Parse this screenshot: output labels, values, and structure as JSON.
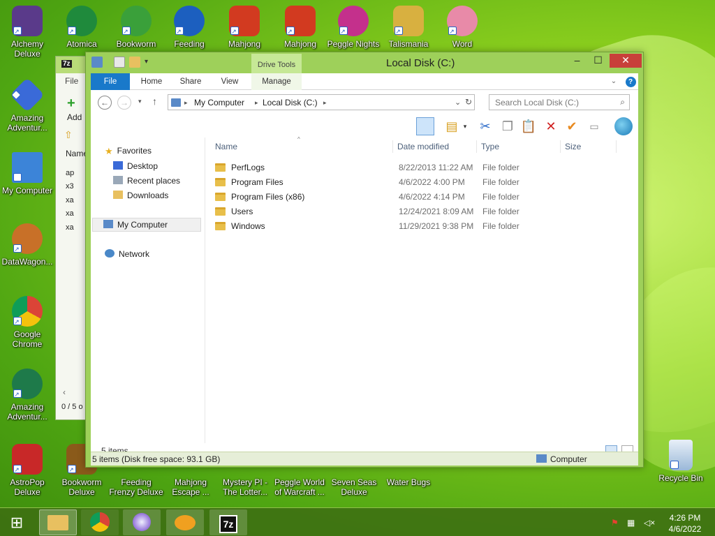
{
  "desktop": {
    "icons_top": [
      {
        "label": "Alchemy Deluxe",
        "color": "#5a3a8a"
      },
      {
        "label": "Atomica",
        "color": "#1f8a3c"
      },
      {
        "label": "Bookworm",
        "color": "#3aa03a"
      },
      {
        "label": "Feeding",
        "color": "#1c5fbf"
      },
      {
        "label": "Mahjong",
        "color": "#d23a20"
      },
      {
        "label": "Mahjong",
        "color": "#d23a20"
      },
      {
        "label": "Peggle Nights",
        "color": "#c4308c"
      },
      {
        "label": "Talismania",
        "color": "#d8b040"
      },
      {
        "label": "Word",
        "color": "#e88aa8"
      }
    ],
    "icons_left": [
      {
        "label": "Amazing Adventur...",
        "color": "#3a6ad8"
      },
      {
        "label": "My Computer",
        "color": "#3c84d8"
      },
      {
        "label": "DataWagon...",
        "color": "#c87028"
      },
      {
        "label": "Google Chrome",
        "color": "#d83a2a"
      },
      {
        "label": "Amazing Adventur...",
        "color": "#1e7a4a"
      }
    ],
    "icons_bottom": [
      {
        "label": "AstroPop Deluxe",
        "color": "#c82828"
      },
      {
        "label": "Bookworm Deluxe",
        "color": "#8a5a1a"
      },
      {
        "label": "Feeding Frenzy Deluxe",
        "color": "#2a78c8"
      },
      {
        "label": "Mahjong Escape ...",
        "color": "#a83a2a"
      },
      {
        "label": "Mystery PI - The Lotter...",
        "color": "#4a4a6a"
      },
      {
        "label": "Peggle World of Warcraft ...",
        "color": "#5a3a9a"
      },
      {
        "label": "Seven Seas Deluxe",
        "color": "#2a6aa8"
      },
      {
        "label": "Water Bugs",
        "color": "#3aa8a8"
      },
      {
        "label": "Recycle Bin",
        "color": "#9ab8d8"
      }
    ]
  },
  "bg_window": {
    "title_icon": "7z",
    "menu_file": "File",
    "add_label": "Add",
    "col_name": "Name",
    "items": [
      "ap",
      "x3",
      "xa",
      "xa",
      "xa"
    ],
    "status": "0 / 5 o"
  },
  "window": {
    "title": "Local Disk (C:)",
    "context_tab": "Drive Tools",
    "tabs": {
      "file": "File",
      "home": "Home",
      "share": "Share",
      "view": "View",
      "manage": "Manage"
    },
    "help": "?",
    "address": {
      "root": "My Computer",
      "current": "Local Disk (C:)"
    },
    "search_placeholder": "Search Local Disk (C:)",
    "columns": {
      "name": "Name",
      "date": "Date modified",
      "type": "Type",
      "size": "Size"
    },
    "nav": {
      "favorites": "Favorites",
      "desktop": "Desktop",
      "recent": "Recent places",
      "downloads": "Downloads",
      "mycomputer": "My Computer",
      "network": "Network"
    },
    "files": [
      {
        "name": "PerfLogs",
        "date": "8/22/2013 11:22 AM",
        "type": "File folder"
      },
      {
        "name": "Program Files",
        "date": "4/6/2022 4:00 PM",
        "type": "File folder"
      },
      {
        "name": "Program Files (x86)",
        "date": "4/6/2022 4:14 PM",
        "type": "File folder"
      },
      {
        "name": "Users",
        "date": "12/24/2021 8:09 AM",
        "type": "File folder"
      },
      {
        "name": "Windows",
        "date": "11/29/2021 9:38 PM",
        "type": "File folder"
      }
    ],
    "item_count": "5 items",
    "detail_text": "5 items (Disk free space: 93.1 GB)",
    "computer_label": "Computer"
  },
  "taskbar": {
    "time": "4:26 PM",
    "date": "4/6/2022",
    "apps": [
      "file-explorer",
      "chrome",
      "gem-app",
      "fish-app",
      "7zip"
    ],
    "seven_zip_label": "7z"
  }
}
